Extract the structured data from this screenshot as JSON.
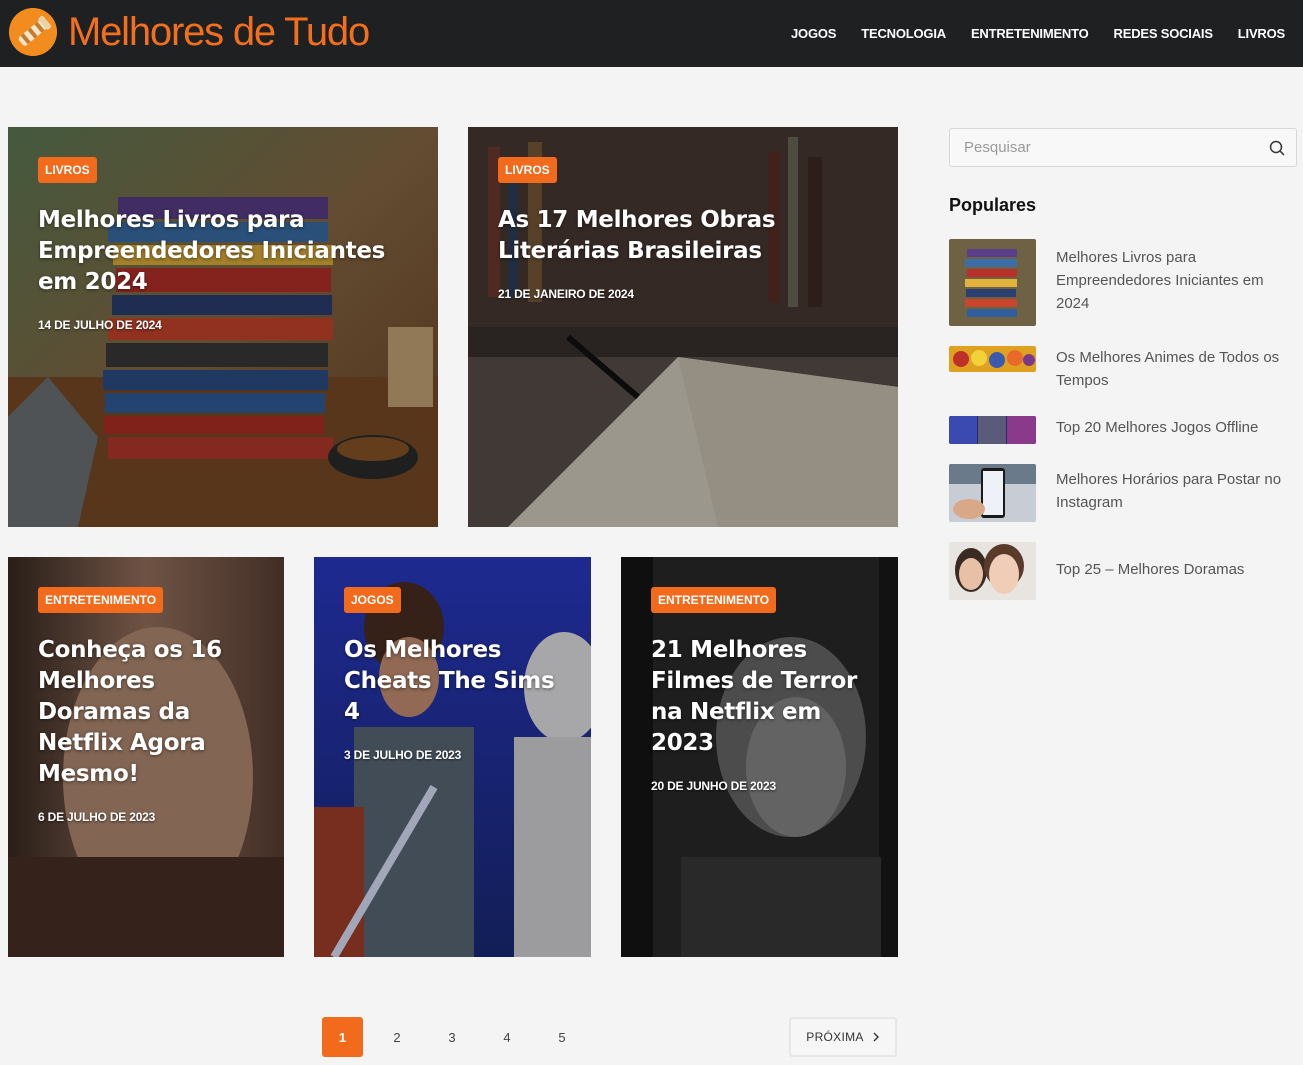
{
  "header": {
    "site_title": "Melhores de Tudo",
    "logo_icon": "telescope-icon",
    "nav": [
      "JOGOS",
      "TECNOLOGIA",
      "ENTRETENIMENTO",
      "REDES SOCIAIS",
      "LIVROS"
    ]
  },
  "colors": {
    "accent": "#f26a1b",
    "header_bg": "#1e2022",
    "page_bg": "#f4f4f4"
  },
  "posts": [
    {
      "category": "LIVROS",
      "title": "Melhores Livros para Empreendedores Iniciantes em 2024",
      "date": "14 DE JULHO DE 2024"
    },
    {
      "category": "LIVROS",
      "title": "As 17 Melhores Obras Literárias Brasileiras",
      "date": "21 DE JANEIRO DE 2024"
    },
    {
      "category": "ENTRETENIMENTO",
      "title": "Conheça os 16 Melhores Doramas da Netflix Agora Mesmo!",
      "date": "6 DE JULHO DE 2023"
    },
    {
      "category": "JOGOS",
      "title": "Os Melhores Cheats The Sims 4",
      "date": "3 DE JULHO DE 2023"
    },
    {
      "category": "ENTRETENIMENTO",
      "title": "21 Melhores Filmes de Terror na Netflix em 2023",
      "date": "20 DE JUNHO DE 2023"
    }
  ],
  "sidebar": {
    "search_placeholder": "Pesquisar",
    "popular_title": "Populares",
    "popular": [
      "Melhores Livros para Empreendedores Iniciantes em 2024",
      "Os Melhores Animes de Todos os Tempos",
      "Top 20 Melhores Jogos Offline",
      "Melhores Horários para Postar no Instagram",
      "Top 25 – Melhores Doramas"
    ]
  },
  "pagination": {
    "current": "1",
    "pages": [
      "2",
      "3",
      "4",
      "5"
    ],
    "next_label": "PRÓXIMA"
  }
}
